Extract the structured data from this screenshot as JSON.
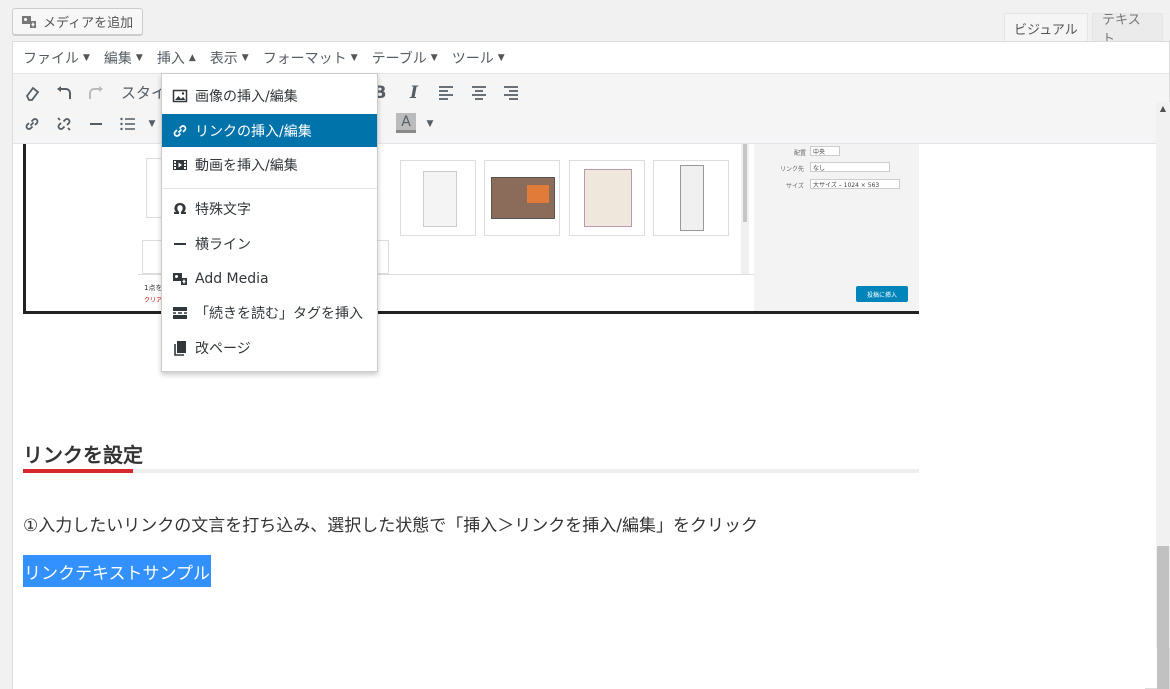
{
  "top": {
    "add_media_label": "メディアを追加",
    "tab_visual": "ビジュアル",
    "tab_text": "テキスト"
  },
  "menubar": {
    "items": [
      "ファイル",
      "編集",
      "挿入",
      "表示",
      "フォーマット",
      "テーブル",
      "ツール"
    ]
  },
  "toolbar": {
    "style_label": "スタイ",
    "text_color_letter": "A"
  },
  "insert_menu": {
    "items": [
      {
        "label": "画像の挿入/編集",
        "icon": "image-icon"
      },
      {
        "label": "リンクの挿入/編集",
        "icon": "link-icon"
      },
      {
        "label": "動画を挿入/編集",
        "icon": "video-icon"
      },
      {
        "label": "特殊文字",
        "icon": "omega-icon"
      },
      {
        "label": "横ライン",
        "icon": "horizontal-line-icon"
      },
      {
        "label": "Add Media",
        "icon": "add-media-icon"
      },
      {
        "label": "「続きを読む」タグを挿入",
        "icon": "read-more-icon"
      },
      {
        "label": "改ページ",
        "icon": "page-break-icon"
      }
    ],
    "active_index": 1
  },
  "embedded_screenshot": {
    "side_labels": [
      "配置",
      "リンク先",
      "サイズ"
    ],
    "side_values": [
      "中央",
      "なし",
      "大サイズ – 1024 × 563"
    ],
    "insert_button": "投稿に挿入",
    "footer_count": "1点を",
    "footer_clear": "クリア"
  },
  "content": {
    "heading": "リンクを設定",
    "paragraph": "①入力したいリンクの文言を打ち込み、選択した状態で「挿入＞リンクを挿入/編集」をクリック",
    "selected_text": "リンクテキストサンプル"
  },
  "colors": {
    "active_menu": "#0073aa",
    "selection": "#3390ff",
    "heading_accent": "#d7282f"
  }
}
